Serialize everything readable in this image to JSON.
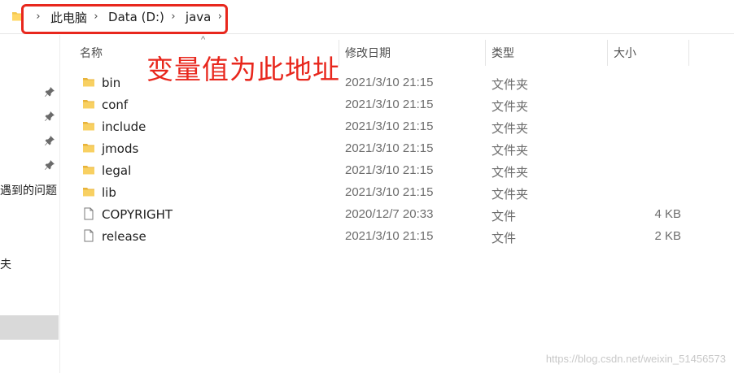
{
  "address": {
    "crumbs": [
      "此电脑",
      "Data (D:)",
      "java"
    ]
  },
  "annotation": "变量值为此地址",
  "nav": {
    "items": [
      "遇到的问题",
      "夫"
    ]
  },
  "columns": {
    "name": "名称",
    "date": "修改日期",
    "type": "类型",
    "size": "大小"
  },
  "files": [
    {
      "name": "bin",
      "date": "2021/3/10 21:15",
      "type": "文件夹",
      "size": "",
      "icon": "folder-icon"
    },
    {
      "name": "conf",
      "date": "2021/3/10 21:15",
      "type": "文件夹",
      "size": "",
      "icon": "folder-icon"
    },
    {
      "name": "include",
      "date": "2021/3/10 21:15",
      "type": "文件夹",
      "size": "",
      "icon": "folder-icon"
    },
    {
      "name": "jmods",
      "date": "2021/3/10 21:15",
      "type": "文件夹",
      "size": "",
      "icon": "folder-icon"
    },
    {
      "name": "legal",
      "date": "2021/3/10 21:15",
      "type": "文件夹",
      "size": "",
      "icon": "folder-icon"
    },
    {
      "name": "lib",
      "date": "2021/3/10 21:15",
      "type": "文件夹",
      "size": "",
      "icon": "folder-icon"
    },
    {
      "name": "COPYRIGHT",
      "date": "2020/12/7 20:33",
      "type": "文件",
      "size": "4 KB",
      "icon": "file-icon"
    },
    {
      "name": "release",
      "date": "2021/3/10 21:15",
      "type": "文件",
      "size": "2 KB",
      "icon": "file-icon"
    }
  ],
  "watermark": "https://blog.csdn.net/weixin_51456573",
  "colors": {
    "highlight": "#e8271d",
    "folder": "#f3c74f",
    "selected": "#d9d9d9"
  }
}
